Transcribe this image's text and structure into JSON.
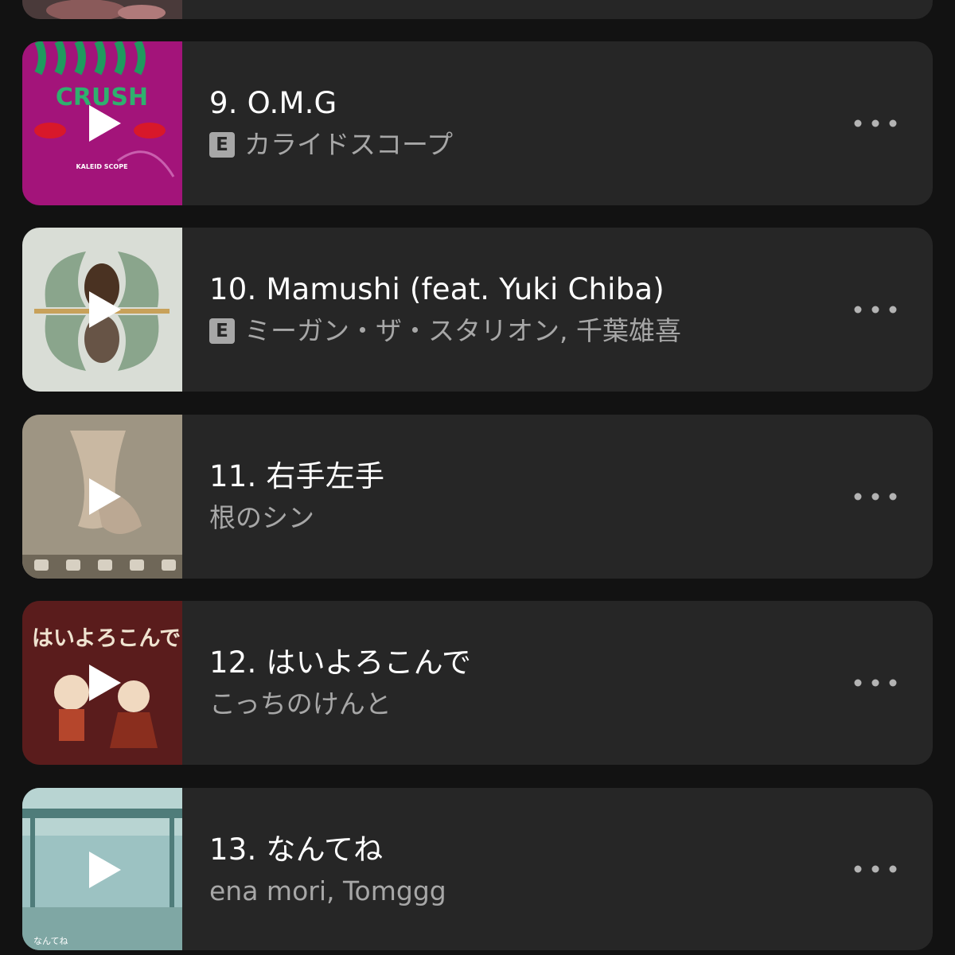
{
  "tracks": [
    {
      "number": "9.",
      "title": "O.M.G",
      "explicit_label": "E",
      "artist": "カライドスコープ",
      "cover_text": "CRUSH",
      "cover_caption": "KALEID SCOPE",
      "colors": {
        "cover_bg": "#a3147a",
        "cover_accent": "#1f9a5e",
        "lips": "#d8182a"
      }
    },
    {
      "number": "10.",
      "title": "Mamushi (feat. Yuki Chiba)",
      "explicit_label": "E",
      "artist": "ミーガン・ザ・スタリオン, 千葉雄喜",
      "colors": {
        "cover_bg": "#d9ddd6",
        "cover_accent": "#8aa58c"
      }
    },
    {
      "number": "11.",
      "title": "右手左手",
      "artist": "根のシン",
      "colors": {
        "cover_bg": "#a89e8c"
      }
    },
    {
      "number": "12.",
      "title": "はいよろこんで",
      "artist": "こっちのけんと",
      "cover_text": "はいよろこんで",
      "colors": {
        "cover_bg": "#5a1c1c",
        "cover_text": "#efe3d0"
      }
    },
    {
      "number": "13.",
      "title": "なんてね",
      "artist": "ena mori, Tomggg",
      "cover_text": "なんてね",
      "colors": {
        "cover_bg": "#9cc2c2"
      }
    }
  ],
  "icons": {
    "play": "play-icon",
    "more": "more-options-icon",
    "explicit": "explicit-badge"
  },
  "theme": {
    "background": "#121212",
    "card": "#262626",
    "title_text": "#ffffff",
    "subtitle_text": "#a7a7a7"
  }
}
